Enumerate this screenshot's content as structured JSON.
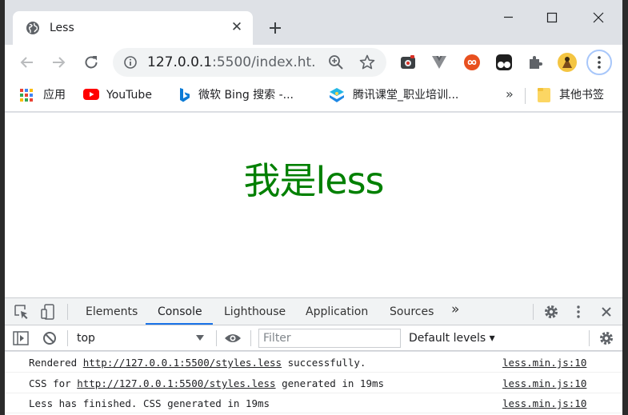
{
  "tab": {
    "title": "Less"
  },
  "omnibox": {
    "url_host": "127.0.0.1",
    "url_rest": ":5500/index.ht..."
  },
  "bookmarks": [
    {
      "label": "应用",
      "icon": "apps-grid-icon"
    },
    {
      "label": "YouTube",
      "icon": "youtube-icon"
    },
    {
      "label": "微软 Bing 搜索 -...",
      "icon": "bing-icon"
    },
    {
      "label": "腾讯课堂_职业培训...",
      "icon": "tencent-classroom-icon"
    }
  ],
  "bookmarks_overflow": "»",
  "other_bookmarks": "其他书签",
  "page": {
    "heading": "我是less"
  },
  "devtools": {
    "tabs": [
      "Elements",
      "Console",
      "Lighthouse",
      "Application",
      "Sources"
    ],
    "active_tab": "Console",
    "more_tabs": "»",
    "context": "top",
    "filter_placeholder": "Filter",
    "levels": "Default levels ▾",
    "logs": [
      {
        "prefix": "Rendered ",
        "link": "http://127.0.0.1:5500/styles.less",
        "suffix": " successfully.",
        "source": "less.min.js:10"
      },
      {
        "prefix": "CSS for ",
        "link": "http://127.0.0.1:5500/styles.less",
        "suffix": " generated in 19ms",
        "source": "less.min.js:10"
      },
      {
        "prefix": "Less has finished. CSS generated in 19ms",
        "link": "",
        "suffix": "",
        "source": "less.min.js:10"
      }
    ]
  },
  "colors": {
    "heading": "#008000",
    "accent": "#1a73e8"
  }
}
